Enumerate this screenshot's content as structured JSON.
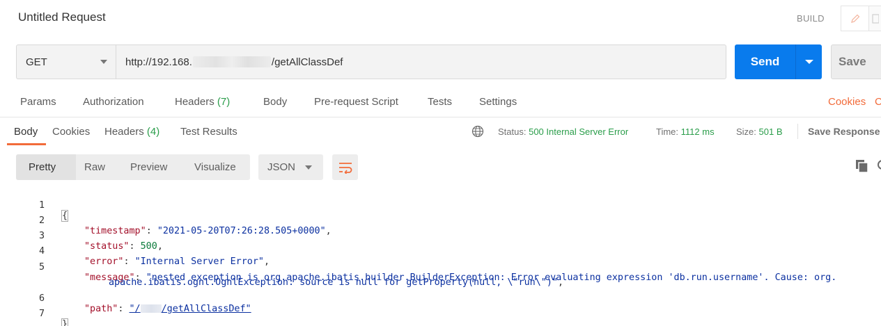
{
  "request": {
    "title": "Untitled Request",
    "build_label": "BUILD",
    "method": "GET",
    "url_prefix": "http://192.168.",
    "url_suffix": "/getAllClassDef",
    "send_label": "Send",
    "save_label": "Save"
  },
  "request_tabs": [
    {
      "label": "Params"
    },
    {
      "label": "Authorization"
    },
    {
      "label": "Headers",
      "count": "(7)"
    },
    {
      "label": "Body"
    },
    {
      "label": "Pre-request Script"
    },
    {
      "label": "Tests"
    },
    {
      "label": "Settings"
    }
  ],
  "cookies_link": "Cookies",
  "cookies_link_clipped": "C",
  "response_tabs": [
    {
      "label": "Body"
    },
    {
      "label": "Cookies"
    },
    {
      "label": "Headers",
      "count": "(4)"
    },
    {
      "label": "Test Results"
    }
  ],
  "response_status": {
    "status_label": "Status:",
    "status_value": "500 Internal Server Error",
    "time_label": "Time:",
    "time_value": "1112 ms",
    "size_label": "Size:",
    "size_value": "501 B",
    "save_response": "Save Response"
  },
  "viewer": {
    "modes": [
      "Pretty",
      "Raw",
      "Preview",
      "Visualize"
    ],
    "active_mode": "Pretty",
    "format": "JSON"
  },
  "colors": {
    "accent": "#f26b3a",
    "send_blue": "#097bed",
    "status_green": "#2a9d4a"
  },
  "body_lines": {
    "n1": "1",
    "n2": "2",
    "n3": "3",
    "n4": "4",
    "n5": "5",
    "n6": "6",
    "n7": "7",
    "open_brace": "{",
    "close_brace": "}",
    "timestamp_key": "\"timestamp\"",
    "timestamp_val": "\"2021-05-20T07:26:28.505+0000\"",
    "status_key": "\"status\"",
    "status_val": "500",
    "error_key": "\"error\"",
    "error_val": "\"Internal Server Error\"",
    "message_key": "\"message\"",
    "message_val_1": "\"nested exception is org.apache.ibatis.builder.BuilderException: Error evaluating expression 'db.run.username'. Cause: org.",
    "message_val_2": "apache.ibatis.ognl.OgnlException: source is null for getProperty(null, \\\"run\\\")\"",
    "path_key": "\"path\"",
    "path_val_prefix": "\"/",
    "path_val_suffix": "/getAllClassDef\""
  }
}
